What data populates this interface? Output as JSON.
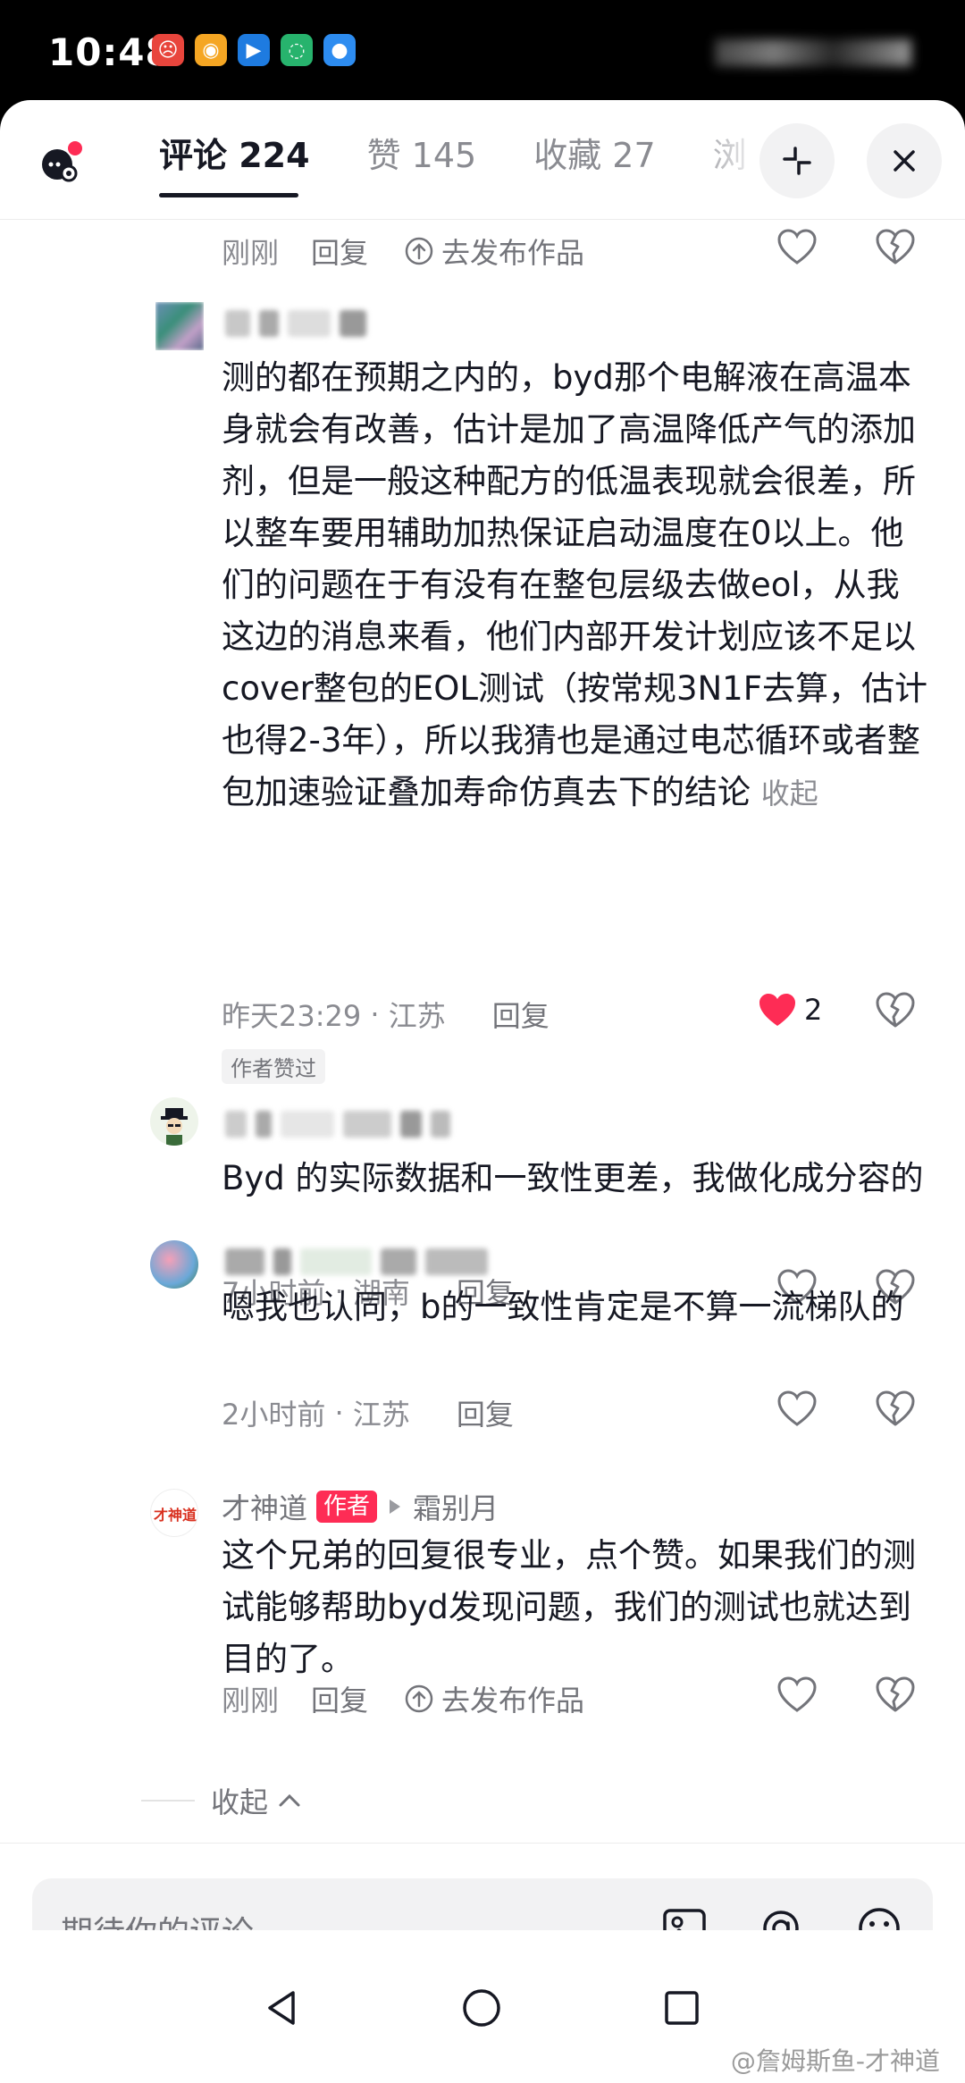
{
  "status_bar": {
    "time": "10:48",
    "icons": [
      "app-red-icon",
      "weibo-icon",
      "blue-app-icon",
      "chat-app-icon",
      "message-app-icon"
    ]
  },
  "header": {
    "tabs": [
      {
        "label": "评论 224",
        "active": true
      },
      {
        "label": "赞 145",
        "active": false
      },
      {
        "label": "收藏 27",
        "active": false
      },
      {
        "label": "浏",
        "active": false
      }
    ]
  },
  "labels": {
    "just_now": "刚刚",
    "reply": "回复",
    "publish_work": "去发布作品",
    "collapse": "收起",
    "author_liked": "作者赞过",
    "author_tag": "作者"
  },
  "comments": [
    {
      "text": "测的都在预期之内的，byd那个电解液在高温本身就会有改善，估计是加了高温降低产气的添加剂，但是一般这种配方的低温表现就会很差，所以整车要用辅助加热保证启动温度在0以上。他们的问题在于有没有在整包层级去做eol，从我这边的消息来看，他们内部开发计划应该不足以cover整包的EOL测试（按常规3N1F去算，估计也得2-3年），所以我猜也是通过电芯循环或者整包加速验证叠加寿命仿真去下的结论",
      "time": "昨天23:29",
      "location": "江苏",
      "likes": "2"
    },
    {
      "text": "Byd 的实际数据和一致性更差，我做化成分容的",
      "time": "7小时前",
      "location": "湖南"
    },
    {
      "text": "嗯我也认同，b的一致性肯定是不算一流梯队的",
      "time": "2小时前",
      "location": "江苏"
    },
    {
      "username": "才神道",
      "reply_to": "霜别月",
      "text": "这个兄弟的回复很专业，点个赞。如果我们的测试能够帮助byd发现问题，我们的测试也就达到目的了。"
    }
  ],
  "input": {
    "placeholder": "期待你的评论"
  },
  "watermark": "@詹姆斯鱼-才神道",
  "colors": {
    "accent": "#fe2c55",
    "text_primary": "#161823",
    "text_secondary": "#8a8b91"
  }
}
